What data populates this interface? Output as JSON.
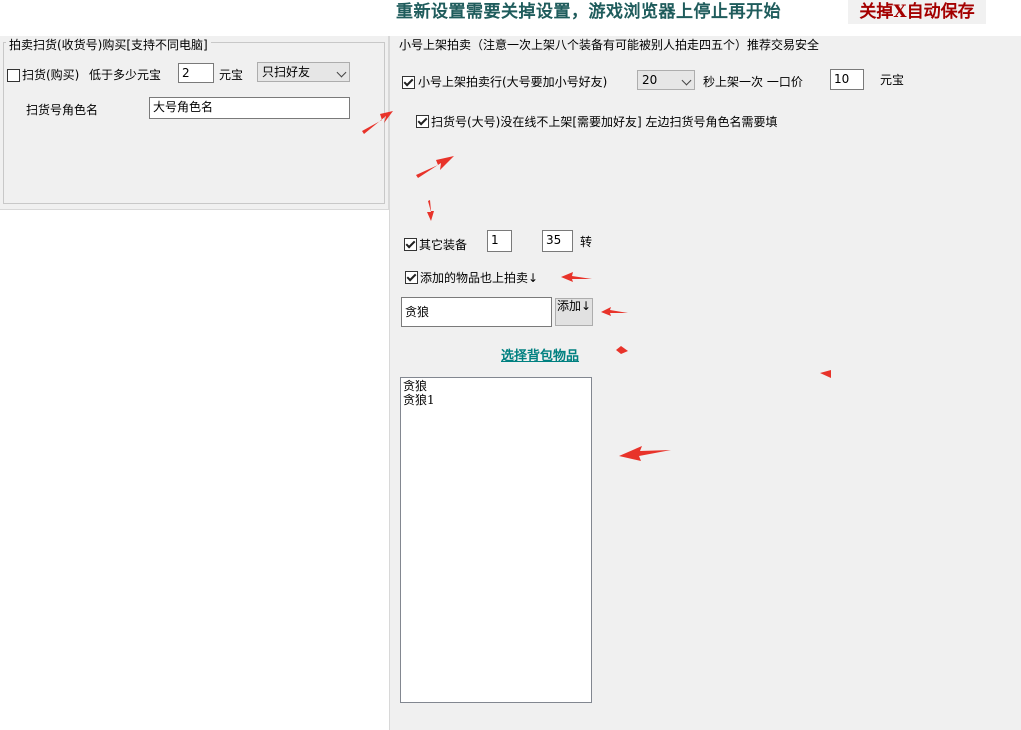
{
  "banner": {
    "notice": "重新设置需要关掉设置，游戏浏览器上停止再开始",
    "close_save": "关掉X自动保存"
  },
  "left_group": {
    "title": "拍卖扫货(收货号)购买[支持不同电脑]",
    "scan_buy_checkbox": {
      "label": "扫货(购买)",
      "checked": false
    },
    "below_price_label": "低于多少元宝",
    "price_value": "2",
    "price_unit": "元宝",
    "friend_filter_select": "只扫好友",
    "scanner_name_label": "扫货号角色名",
    "scanner_name_value": "大号角色名"
  },
  "right_group": {
    "title": "小号上架拍卖（注意一次上架八个装备有可能被别人拍走四五个）推荐交易安全",
    "alt_auction_checkbox": {
      "label": "小号上架拍卖行(大号要加小号好友)",
      "checked": true
    },
    "interval_select": "20",
    "interval_label": "秒上架一次 一口价",
    "buyout_value": "10",
    "buyout_unit": "元宝",
    "offline_checkbox": {
      "label": "扫货号(大号)没在线不上架[需要加好友] 左边扫货号角色名需要填",
      "checked": true
    },
    "other_equip_checkbox": {
      "label": "其它装备",
      "checked": true
    },
    "other_equip_min": "1",
    "other_equip_max": "35",
    "reincarnation_label": "转",
    "added_items_checkbox": {
      "label": "添加的物品也上拍卖↓",
      "checked": true
    },
    "item_input": "贪狼",
    "add_button": "添加↓",
    "select_bag_link": "选择背包物品",
    "item_list": [
      "贪狼",
      "贪狼1"
    ]
  },
  "colors": {
    "banner_text": "#1f5c5c",
    "close_text": "#a40000",
    "link": "#008080",
    "annotation_arrow": "#e8332a",
    "panel_bg": "#f0f0f0"
  }
}
